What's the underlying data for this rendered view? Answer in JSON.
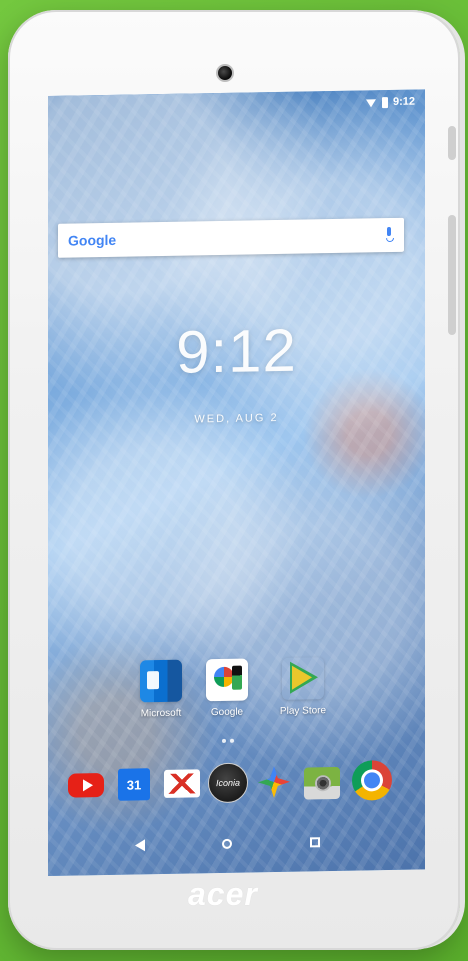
{
  "status_bar": {
    "time": "9:12"
  },
  "search_widget": {
    "brand": "Google"
  },
  "clock": {
    "time": "9:12",
    "date": "WED, AUG 2"
  },
  "home_folders": [
    {
      "label": "Microsoft",
      "icon": "microsoft-folder-icon"
    },
    {
      "label": "Google",
      "icon": "google-folder-icon"
    },
    {
      "label": "Play Store",
      "icon": "play-store-icon"
    }
  ],
  "dock": [
    {
      "label": "",
      "icon": "youtube-icon"
    },
    {
      "label": "31",
      "icon": "calendar-icon"
    },
    {
      "label": "",
      "icon": "gmail-icon"
    },
    {
      "label": "Iconia",
      "icon": "iconia-icon"
    },
    {
      "label": "",
      "icon": "photos-icon"
    },
    {
      "label": "",
      "icon": "camera-icon"
    },
    {
      "label": "",
      "icon": "chrome-icon"
    }
  ],
  "navigation": {
    "back_icon": "back-icon",
    "home_icon": "home-icon",
    "recent_icon": "recent-apps-icon"
  },
  "device": {
    "brand": "acer"
  },
  "colors": {
    "background": "#6cc23a",
    "device": "#f1f1f1",
    "screen": "#6a9fd6",
    "google_blue": "#4285f4"
  }
}
